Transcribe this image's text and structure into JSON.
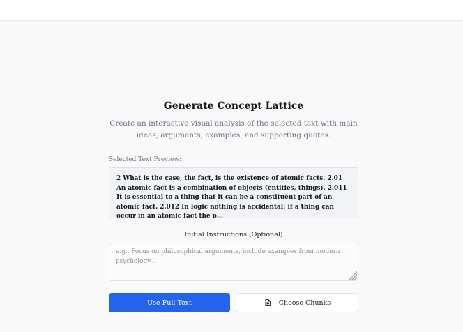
{
  "dialog": {
    "title": "Generate Concept Lattice",
    "subtitle": "Create an interactive visual analysis of the selected text with main ideas, arguments, examples, and supporting quotes.",
    "preview_label": "Selected Text Preview:",
    "preview_text": "2 What is the case, the fact, is the existence of atomic facts. 2.01 An atomic fact is a combination of objects (entities, things). 2.011 It is essential to a thing that it can be a constituent part of an atomic fact. 2.012 In logic nothing is accidental: if a thing can occur in an atomic fact the p...",
    "instructions_label": "Initial Instructions (Optional)",
    "instructions_value": "",
    "instructions_placeholder": "e.g., Focus on philosophical arguments, include examples from modern psychology...",
    "primary_button": "Use Full Text",
    "secondary_button": "Choose Chunks",
    "secondary_button_icon": "document-icon"
  },
  "colors": {
    "accent": "#2463eb",
    "muted_text": "#6b7385",
    "preview_bg": "#f1f3f7"
  }
}
